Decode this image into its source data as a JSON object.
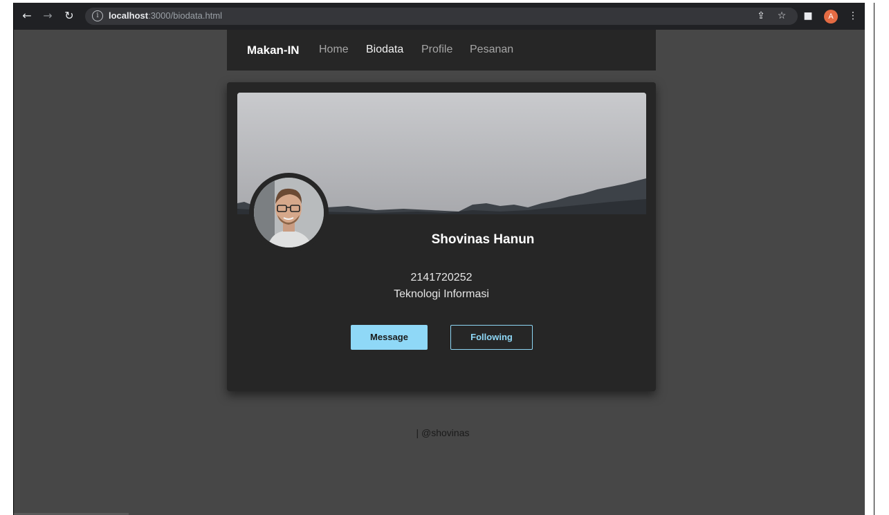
{
  "browser": {
    "url_host": "localhost",
    "url_path": ":3000/biodata.html",
    "info_symbol": "i",
    "profile_initial": "A"
  },
  "navbar": {
    "brand": "Makan-IN",
    "links": [
      "Home",
      "Biodata",
      "Profile",
      "Pesanan"
    ],
    "active": "Biodata"
  },
  "profile": {
    "name": "Shovinas Hanun",
    "nim": "2141720252",
    "jurusan": "Teknologi Informasi"
  },
  "buttons": {
    "message": "Message",
    "following": "Following"
  },
  "footer": {
    "text": "| @shovinas"
  },
  "colors": {
    "page_bg": "#474747",
    "card_bg": "#262626",
    "accent": "#8fd8f7"
  }
}
